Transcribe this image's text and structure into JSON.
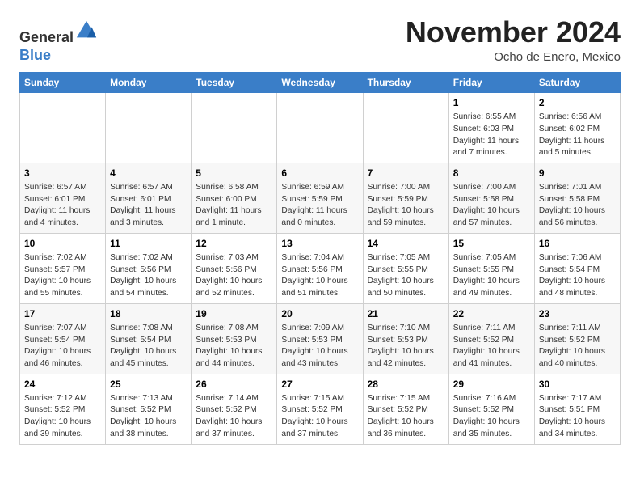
{
  "header": {
    "logo": {
      "line1": "General",
      "line2": "Blue"
    },
    "title": "November 2024",
    "subtitle": "Ocho de Enero, Mexico"
  },
  "columns": [
    "Sunday",
    "Monday",
    "Tuesday",
    "Wednesday",
    "Thursday",
    "Friday",
    "Saturday"
  ],
  "weeks": [
    [
      {
        "day": "",
        "info": ""
      },
      {
        "day": "",
        "info": ""
      },
      {
        "day": "",
        "info": ""
      },
      {
        "day": "",
        "info": ""
      },
      {
        "day": "",
        "info": ""
      },
      {
        "day": "1",
        "info": "Sunrise: 6:55 AM\nSunset: 6:03 PM\nDaylight: 11 hours\nand 7 minutes."
      },
      {
        "day": "2",
        "info": "Sunrise: 6:56 AM\nSunset: 6:02 PM\nDaylight: 11 hours\nand 5 minutes."
      }
    ],
    [
      {
        "day": "3",
        "info": "Sunrise: 6:57 AM\nSunset: 6:01 PM\nDaylight: 11 hours\nand 4 minutes."
      },
      {
        "day": "4",
        "info": "Sunrise: 6:57 AM\nSunset: 6:01 PM\nDaylight: 11 hours\nand 3 minutes."
      },
      {
        "day": "5",
        "info": "Sunrise: 6:58 AM\nSunset: 6:00 PM\nDaylight: 11 hours\nand 1 minute."
      },
      {
        "day": "6",
        "info": "Sunrise: 6:59 AM\nSunset: 5:59 PM\nDaylight: 11 hours\nand 0 minutes."
      },
      {
        "day": "7",
        "info": "Sunrise: 7:00 AM\nSunset: 5:59 PM\nDaylight: 10 hours\nand 59 minutes."
      },
      {
        "day": "8",
        "info": "Sunrise: 7:00 AM\nSunset: 5:58 PM\nDaylight: 10 hours\nand 57 minutes."
      },
      {
        "day": "9",
        "info": "Sunrise: 7:01 AM\nSunset: 5:58 PM\nDaylight: 10 hours\nand 56 minutes."
      }
    ],
    [
      {
        "day": "10",
        "info": "Sunrise: 7:02 AM\nSunset: 5:57 PM\nDaylight: 10 hours\nand 55 minutes."
      },
      {
        "day": "11",
        "info": "Sunrise: 7:02 AM\nSunset: 5:56 PM\nDaylight: 10 hours\nand 54 minutes."
      },
      {
        "day": "12",
        "info": "Sunrise: 7:03 AM\nSunset: 5:56 PM\nDaylight: 10 hours\nand 52 minutes."
      },
      {
        "day": "13",
        "info": "Sunrise: 7:04 AM\nSunset: 5:56 PM\nDaylight: 10 hours\nand 51 minutes."
      },
      {
        "day": "14",
        "info": "Sunrise: 7:05 AM\nSunset: 5:55 PM\nDaylight: 10 hours\nand 50 minutes."
      },
      {
        "day": "15",
        "info": "Sunrise: 7:05 AM\nSunset: 5:55 PM\nDaylight: 10 hours\nand 49 minutes."
      },
      {
        "day": "16",
        "info": "Sunrise: 7:06 AM\nSunset: 5:54 PM\nDaylight: 10 hours\nand 48 minutes."
      }
    ],
    [
      {
        "day": "17",
        "info": "Sunrise: 7:07 AM\nSunset: 5:54 PM\nDaylight: 10 hours\nand 46 minutes."
      },
      {
        "day": "18",
        "info": "Sunrise: 7:08 AM\nSunset: 5:54 PM\nDaylight: 10 hours\nand 45 minutes."
      },
      {
        "day": "19",
        "info": "Sunrise: 7:08 AM\nSunset: 5:53 PM\nDaylight: 10 hours\nand 44 minutes."
      },
      {
        "day": "20",
        "info": "Sunrise: 7:09 AM\nSunset: 5:53 PM\nDaylight: 10 hours\nand 43 minutes."
      },
      {
        "day": "21",
        "info": "Sunrise: 7:10 AM\nSunset: 5:53 PM\nDaylight: 10 hours\nand 42 minutes."
      },
      {
        "day": "22",
        "info": "Sunrise: 7:11 AM\nSunset: 5:52 PM\nDaylight: 10 hours\nand 41 minutes."
      },
      {
        "day": "23",
        "info": "Sunrise: 7:11 AM\nSunset: 5:52 PM\nDaylight: 10 hours\nand 40 minutes."
      }
    ],
    [
      {
        "day": "24",
        "info": "Sunrise: 7:12 AM\nSunset: 5:52 PM\nDaylight: 10 hours\nand 39 minutes."
      },
      {
        "day": "25",
        "info": "Sunrise: 7:13 AM\nSunset: 5:52 PM\nDaylight: 10 hours\nand 38 minutes."
      },
      {
        "day": "26",
        "info": "Sunrise: 7:14 AM\nSunset: 5:52 PM\nDaylight: 10 hours\nand 37 minutes."
      },
      {
        "day": "27",
        "info": "Sunrise: 7:15 AM\nSunset: 5:52 PM\nDaylight: 10 hours\nand 37 minutes."
      },
      {
        "day": "28",
        "info": "Sunrise: 7:15 AM\nSunset: 5:52 PM\nDaylight: 10 hours\nand 36 minutes."
      },
      {
        "day": "29",
        "info": "Sunrise: 7:16 AM\nSunset: 5:52 PM\nDaylight: 10 hours\nand 35 minutes."
      },
      {
        "day": "30",
        "info": "Sunrise: 7:17 AM\nSunset: 5:51 PM\nDaylight: 10 hours\nand 34 minutes."
      }
    ]
  ]
}
